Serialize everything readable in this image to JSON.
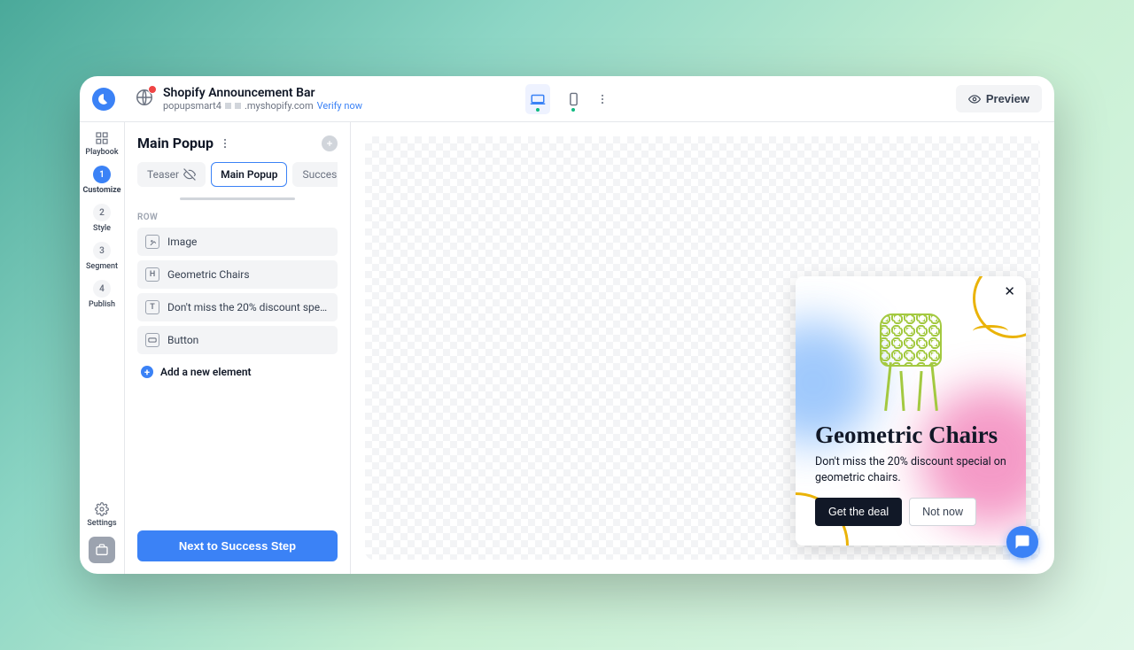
{
  "header": {
    "title": "Shopify Announcement Bar",
    "subtitle_prefix": "popupsmart4",
    "domain": ".myshopify.com",
    "verify": "Verify now",
    "preview": "Preview"
  },
  "rail": {
    "playbook": "Playbook",
    "steps": [
      {
        "num": "1",
        "label": "Customize"
      },
      {
        "num": "2",
        "label": "Style"
      },
      {
        "num": "3",
        "label": "Segment"
      },
      {
        "num": "4",
        "label": "Publish"
      }
    ],
    "settings": "Settings"
  },
  "panel": {
    "title": "Main Popup",
    "tabs": {
      "teaser": "Teaser",
      "main": "Main Popup",
      "success": "Success Step"
    },
    "rowLabel": "ROW",
    "elements": {
      "image": "Image",
      "heading": "Geometric Chairs",
      "text": "Don't miss the 20% discount special on ge...",
      "button": "Button"
    },
    "addElement": "Add a new element",
    "next": "Next to Success Step"
  },
  "popup": {
    "title": "Geometric Chairs",
    "desc": "Don't miss the 20% discount special on geometric chairs.",
    "primary": "Get the deal",
    "secondary": "Not now"
  }
}
